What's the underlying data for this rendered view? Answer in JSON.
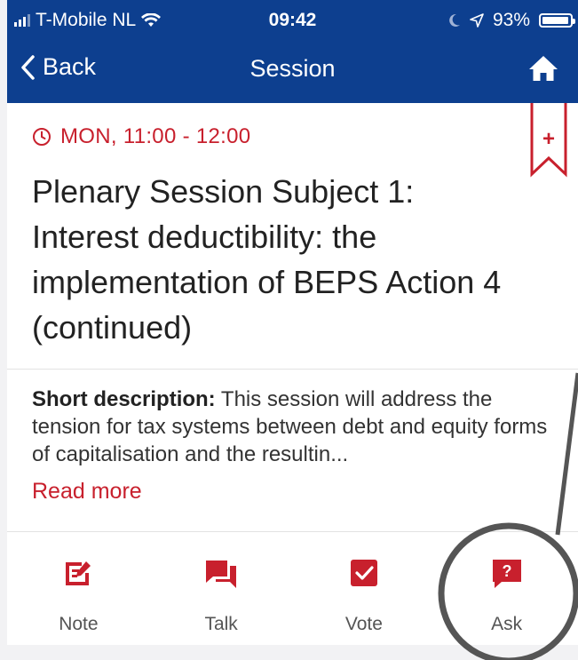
{
  "status_bar": {
    "carrier": "T-Mobile NL",
    "time": "09:42",
    "battery": "93%"
  },
  "nav": {
    "back_label": "Back",
    "title": "Session"
  },
  "session": {
    "time": "MON, 11:00 - 12:00",
    "title": "Plenary Session Subject 1: Interest deductibility: the implementation of BEPS Action 4 (continued)",
    "desc_label": "Short description:",
    "desc_text": " This session will address the tension for tax systems between debt and equity forms of capitalisation and the resultin...",
    "read_more": "Read more",
    "bookmark_symbol": "+"
  },
  "actions": [
    {
      "label": "Note",
      "icon": "note-edit-icon"
    },
    {
      "label": "Talk",
      "icon": "chat-bubbles-icon"
    },
    {
      "label": "Vote",
      "icon": "checkbox-icon"
    },
    {
      "label": "Ask",
      "icon": "question-icon"
    }
  ],
  "colors": {
    "header": "#0d3f8f",
    "accent": "#c8202d"
  }
}
